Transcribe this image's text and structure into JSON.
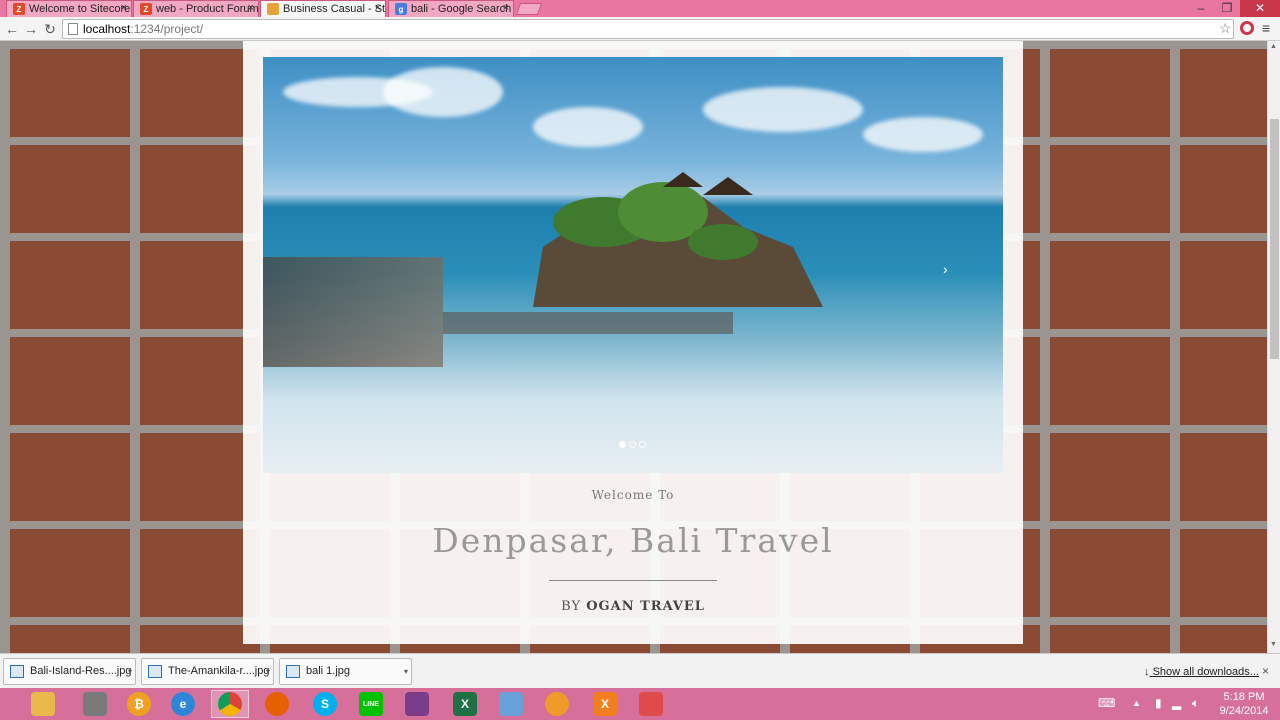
{
  "browser": {
    "tabs": [
      {
        "label": "Welcome to Sitecore",
        "fav_color": "#e04a2a",
        "fav_glyph": "Z"
      },
      {
        "label": "web - Product Forum",
        "fav_color": "#e04a2a",
        "fav_glyph": "Z"
      },
      {
        "label": "Business Casual - Sta",
        "fav_color": "#e8a23a",
        "fav_glyph": ""
      },
      {
        "label": "bali - Google Search",
        "fav_color": "#4a7be0",
        "fav_glyph": "g"
      }
    ],
    "url_host": "localhost",
    "url_path": ":1234/project/"
  },
  "page": {
    "welcome": "Welcome To",
    "title": "Denpasar, Bali Travel",
    "by": "BY",
    "brand": "OGAN TRAVEL",
    "next_arrow": "›"
  },
  "downloads": {
    "items": [
      "Bali-Island-Res....jpg",
      "The-Amankila-r....jpg",
      "bali 1.jpg"
    ],
    "show_all": "Show all downloads...",
    "download_icon": "↓"
  },
  "taskbar": {
    "apps": [
      {
        "name": "file-explorer",
        "color": "#e8b84a",
        "glyph": ""
      },
      {
        "name": "printer",
        "color": "#7a7a7a",
        "glyph": ""
      },
      {
        "name": "bitcoin",
        "color": "#f0a020",
        "glyph": "₿"
      },
      {
        "name": "internet-explorer",
        "color": "#2f86d8",
        "glyph": "e"
      },
      {
        "name": "chrome",
        "color": "#db4437",
        "glyph": ""
      },
      {
        "name": "firefox",
        "color": "#e66000",
        "glyph": ""
      },
      {
        "name": "skype",
        "color": "#00aff0",
        "glyph": "S"
      },
      {
        "name": "line",
        "color": "#00c300",
        "glyph": "LINE"
      },
      {
        "name": "winrar",
        "color": "#7a3d8a",
        "glyph": ""
      },
      {
        "name": "excel",
        "color": "#1e7145",
        "glyph": "X"
      },
      {
        "name": "photos",
        "color": "#6a9fd8",
        "glyph": ""
      },
      {
        "name": "sublime",
        "color": "#f09a2a",
        "glyph": ""
      },
      {
        "name": "xampp",
        "color": "#f37e1e",
        "glyph": "X"
      },
      {
        "name": "app-red",
        "color": "#e04a4a",
        "glyph": ""
      }
    ],
    "time": "5:18 PM",
    "date": "9/24/2014"
  }
}
